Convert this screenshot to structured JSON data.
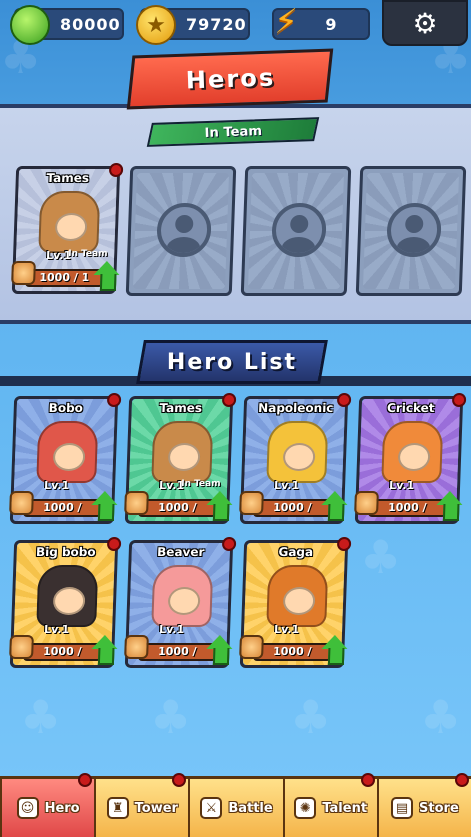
{
  "resources": {
    "gems": "80000",
    "coins": "79720",
    "energy": "9"
  },
  "header": {
    "title": "Heros",
    "in_team_label": "In Team"
  },
  "team": [
    {
      "name": "Tames",
      "level": "Lv.1",
      "status": "In Team",
      "fragments": "1000 / 1",
      "portrait_color": "#c98a4a",
      "c1": "#c7d0e6",
      "c2": "#b6c0da"
    }
  ],
  "hero_list_title": "Hero List",
  "heroes": [
    {
      "name": "Bobo",
      "level": "Lv.1",
      "status": "",
      "fragments": "1000 /",
      "portrait_color": "#e0574a",
      "c1": "#8fb0e8",
      "c2": "#7c9ddb"
    },
    {
      "name": "Tames",
      "level": "Lv.1",
      "status": "In Team",
      "fragments": "1000 /",
      "portrait_color": "#c98a4a",
      "c1": "#6cd9a8",
      "c2": "#4fc792"
    },
    {
      "name": "Napoleonic",
      "level": "Lv.1",
      "status": "",
      "fragments": "1000 /",
      "portrait_color": "#f4c23a",
      "c1": "#8fb0e8",
      "c2": "#7c9ddb"
    },
    {
      "name": "Cricket",
      "level": "Lv.1",
      "status": "",
      "fragments": "1000 /",
      "portrait_color": "#f08a3a",
      "c1": "#b08ae8",
      "c2": "#9a6ed9"
    },
    {
      "name": "Big bobo",
      "level": "Lv.1",
      "status": "",
      "fragments": "1000 /",
      "portrait_color": "#3a3030",
      "c1": "#ffd36a",
      "c2": "#f5c24a"
    },
    {
      "name": "Beaver",
      "level": "Lv.1",
      "status": "",
      "fragments": "1000 /",
      "portrait_color": "#f59a9a",
      "c1": "#8fb0e8",
      "c2": "#7c9ddb"
    },
    {
      "name": "Gaga",
      "level": "Lv.1",
      "status": "",
      "fragments": "1000 /",
      "portrait_color": "#e07a2a",
      "c1": "#ffd36a",
      "c2": "#f5c24a"
    }
  ],
  "nav": [
    {
      "label": "Hero",
      "icon": "hero-icon"
    },
    {
      "label": "Tower",
      "icon": "tower-icon"
    },
    {
      "label": "Battle",
      "icon": "battle-icon"
    },
    {
      "label": "Talent",
      "icon": "talent-icon"
    },
    {
      "label": "Store",
      "icon": "store-icon"
    }
  ]
}
